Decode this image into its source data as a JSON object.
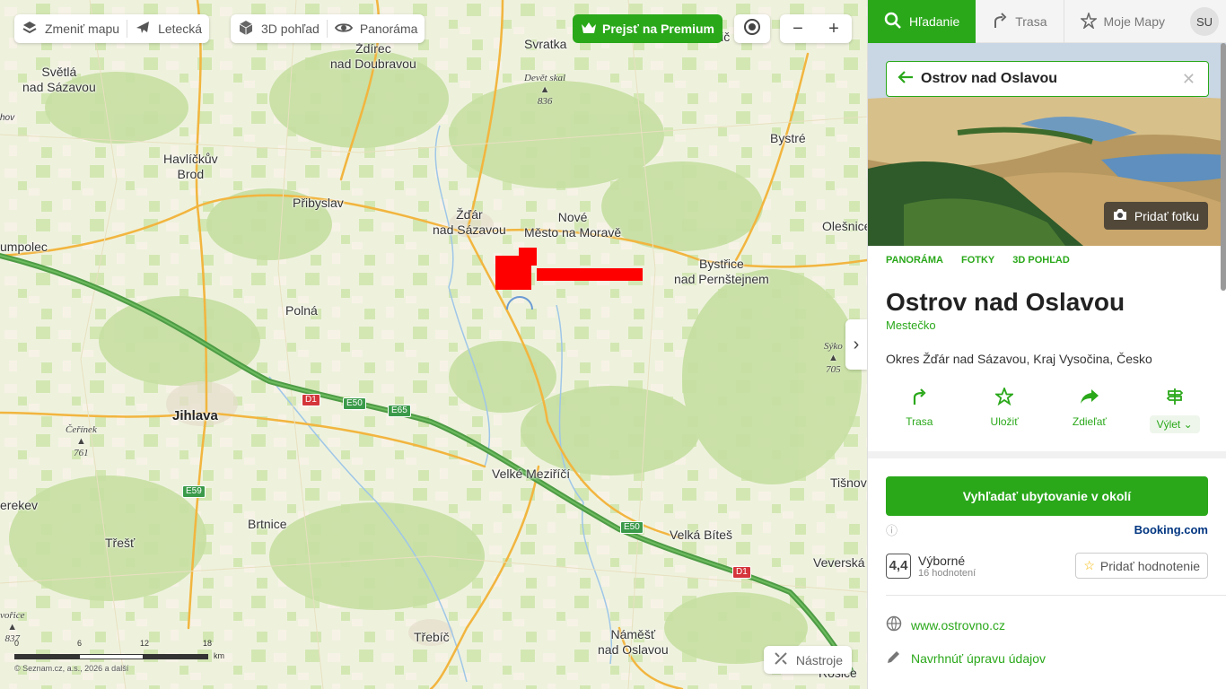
{
  "map": {
    "toolbar": {
      "change_map": "Zmeniť mapu",
      "aerial": "Letecká",
      "view_3d": "3D pohľad",
      "panorama": "Panoráma",
      "premium": "Prejsť na Premium"
    },
    "tools": "Nástroje",
    "scale": {
      "n0": "0",
      "n6": "6",
      "n12": "12",
      "n18": "18",
      "unit": "km"
    },
    "copyright": "© Seznam.cz, a.s., 2026 a další",
    "places": {
      "svetla": "Světlá\nnad Sázavou",
      "zdirec": "Ždírec\nnad Doubravou",
      "svratka": "Svratka",
      "havlickuv": "Havlíčkův\nBrod",
      "bystre": "Bystré",
      "pribyslav": "Přibyslav",
      "zdar": "Žďár\nnad Sázavou",
      "nove_mesto": "Nové\nMěsto na Moravě",
      "olesnice": "Olešnice",
      "humpolec": "umpolec",
      "bystrice": "Bystřice\nnad Pernštejnem",
      "polna": "Polná",
      "jihlava": "Jihlava",
      "velke_mezirici": "Velké Meziříčí",
      "tisnov": "Tišnov",
      "pelhrimov_part": "erekev",
      "brtnice": "Brtnice",
      "velka_bites": "Velká Bíteš",
      "trest": "Třešť",
      "veverska": "Veverská",
      "trebic": "Třebíč",
      "namest": "Náměšť\nnad Oslavou",
      "rosice": "Rosice",
      "hov": "hov"
    },
    "peaks": {
      "devet_skal": "Devět skal",
      "devet_skal_h": "836",
      "cerinek": "Čeřínek",
      "cerinek_h": "761",
      "sykovec": "Sýko",
      "sykovec_h": "705",
      "javorice": "vořice",
      "javorice_h": "837"
    },
    "roads": {
      "d1a": "D1",
      "e50a": "E50",
      "e65": "E65",
      "e59": "E59",
      "e50b": "E50",
      "d1b": "D1"
    }
  },
  "panel": {
    "tabs": {
      "search": "Hľadanie",
      "route": "Trasa",
      "mymaps": "Moje Mapy",
      "avatar": "SU"
    },
    "search": {
      "value": "Ostrov nad Oslavou"
    },
    "add_photo": "Pridať fotku",
    "photo_tabs": [
      "PANORÁMA",
      "FOTKY",
      "3D POHĽAD"
    ],
    "place": {
      "name": "Ostrov nad Oslavou",
      "type": "Mestečko",
      "address": "Okres Žďár nad Sázavou, Kraj Vysočina, Česko"
    },
    "actions": {
      "route": "Trasa",
      "save": "Uložiť",
      "share": "Zdieľať",
      "trip": "Výlet"
    },
    "accommodation": "Vyhľadať ubytovanie v okolí",
    "booking": "Booking.com",
    "rating": {
      "score": "4,4",
      "label": "Výborné",
      "count": "16 hodnotení",
      "add": "Pridať hodnotenie"
    },
    "website": "www.ostrovno.cz",
    "suggest": "Navrhnúť úpravu údajov"
  },
  "colors": {
    "accent": "#2aa81a",
    "highway": "#3e8f3a",
    "road": "#f2b53f",
    "forest": "#c6dfa2"
  }
}
